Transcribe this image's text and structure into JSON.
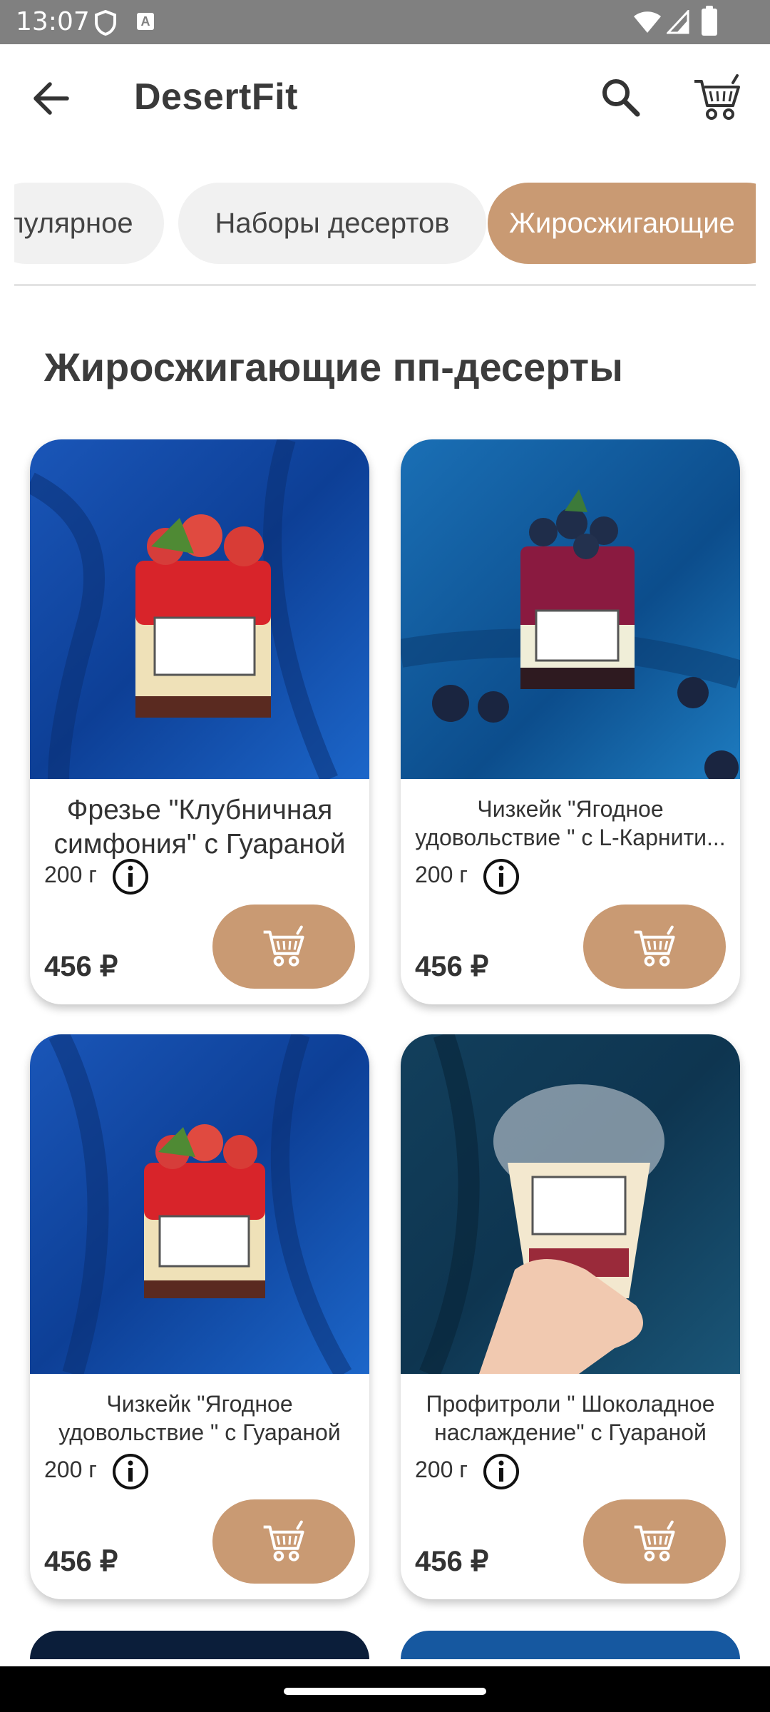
{
  "status": {
    "time": "13:07",
    "keyboard_badge": "A"
  },
  "app_bar": {
    "title": "DesertFit"
  },
  "chips": [
    {
      "label": "пулярное"
    },
    {
      "label": "Наборы десертов"
    },
    {
      "label": "Жиросжигающие"
    }
  ],
  "section": {
    "title": "Жиросжигающие пп-десерты"
  },
  "products": [
    {
      "name": "Фрезье \"Клубничная симфония\" с Гуараной",
      "weight": "200 г",
      "price": "456 ₽"
    },
    {
      "name_line1": "Чизкейк \"Ягодное",
      "name_line2": "удовольствие \" с L-Карнити...",
      "weight": "200 г",
      "price": "456 ₽"
    },
    {
      "name_line1": "Чизкейк \"Ягодное",
      "name_line2": "удовольствие \" с Гуараной",
      "weight": "200 г",
      "price": "456 ₽"
    },
    {
      "name_line1": "Профитроли \" Шоколадное",
      "name_line2": "наслаждение\" с Гуараной",
      "weight": "200 г",
      "price": "456 ₽"
    }
  ],
  "colors": {
    "accent": "#c99a73",
    "status_bar": "#808080",
    "chip_bg": "#f1f1f1"
  },
  "icons": {
    "back": "arrow-left-icon",
    "search": "search-icon",
    "cart": "cart-icon",
    "info": "info-icon",
    "add_to_cart": "cart-icon"
  }
}
